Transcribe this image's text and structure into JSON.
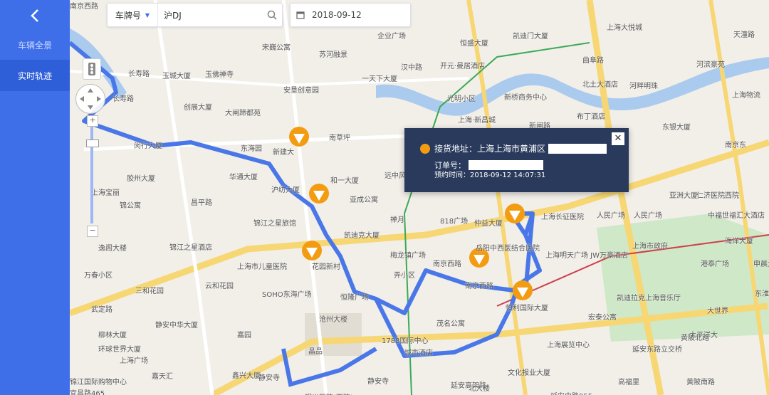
{
  "sidebar": {
    "back_icon": "chevron-left-icon",
    "items": [
      {
        "label": "车辆全景",
        "active": false
      },
      {
        "label": "实时轨迹",
        "active": true
      }
    ]
  },
  "search": {
    "plate_label": "车牌号",
    "plate_value": "沪DJ",
    "search_icon": "search-icon"
  },
  "date": {
    "value": "2018-09-12",
    "icon": "calendar-icon"
  },
  "popup": {
    "pickup_label": "接货地址：上海上海市黄浦区",
    "order_label": "订单号：",
    "time_label": "预约时间：2018-09-12 14:07:31",
    "close_label": "✕"
  },
  "map": {
    "zoom_plus": "+",
    "zoom_minus": "−",
    "labels": [
      "长寿路",
      "长寿路",
      "玉城大厦",
      "玉佛禅寺",
      "宋巍公寓",
      "苏河融景",
      "企业广场",
      "恒盛大厦",
      "凯迪门大厦",
      "上海大悦城",
      "天潼路",
      "汉中路",
      "开元·曼居酒店",
      "曲阜路",
      "河滨豪苑",
      "一天下大厦",
      "安垦创意园",
      "光明小区",
      "新桥商务中心",
      "北土大酒店",
      "河畔明珠",
      "上海物流",
      "创展大厦",
      "大闸蹄都苑",
      "上海·新昌城",
      "布丁酒店",
      "新闸路",
      "东银大厦",
      "南京东",
      "南草坪",
      "东海园",
      "新建大",
      "闵行大厦",
      "华通大厦",
      "和一大厦",
      "远中风",
      "胶州大厦",
      "上海宝丽",
      "亚成公寓",
      "禅月",
      "818广场",
      "仲益大厦",
      "上海长征医院",
      "人民广场",
      "人民广场",
      "亚洲大厦",
      "仁济医院西院",
      "中福世福汇大酒店",
      "锦江之星旅馆",
      "锦公寓",
      "昌平路",
      "凯迪克大厦",
      "沪纺大厦",
      "梅龙镇广场",
      "南京西路",
      "岳阳中西医结合医院",
      "上海明天广场 JW万豪酒店",
      "上海市政府",
      "海洋大厦",
      "港泰广场",
      "申晨大厦",
      "逸阁大楼",
      "锦江之星酒店",
      "上海市儿童医院",
      "花园新村",
      "南京西路",
      "恒利国际大厦",
      "凯迪拉克上海音乐厅",
      "大世界",
      "东淮海公",
      "三和花园",
      "云和花园",
      "SOHO东海广场",
      "恒隆广场",
      "宏泰公寓",
      "万春小区",
      "武定路",
      "静安中华大厦",
      "沧州大楼",
      "茂名公寓",
      "太平洋大",
      "柳林大厦",
      "嘉园",
      "晶品",
      "上海展览中心",
      "延安东路立交桥",
      "黄陂北路",
      "环球世界大厦",
      "上海广场",
      "嘉天汇",
      "1788国际中心",
      "文化报业大厦",
      "鑫兴大厦",
      "静安寺",
      "静安寺",
      "城市酒店",
      "延安高架路",
      "北大楼",
      "高福里",
      "黄陂南路",
      "曙光医院(西院)",
      "延安中路955",
      "锦江国际购物中心",
      "宜昌路465",
      "弄小区",
      "南京西路"
    ]
  }
}
